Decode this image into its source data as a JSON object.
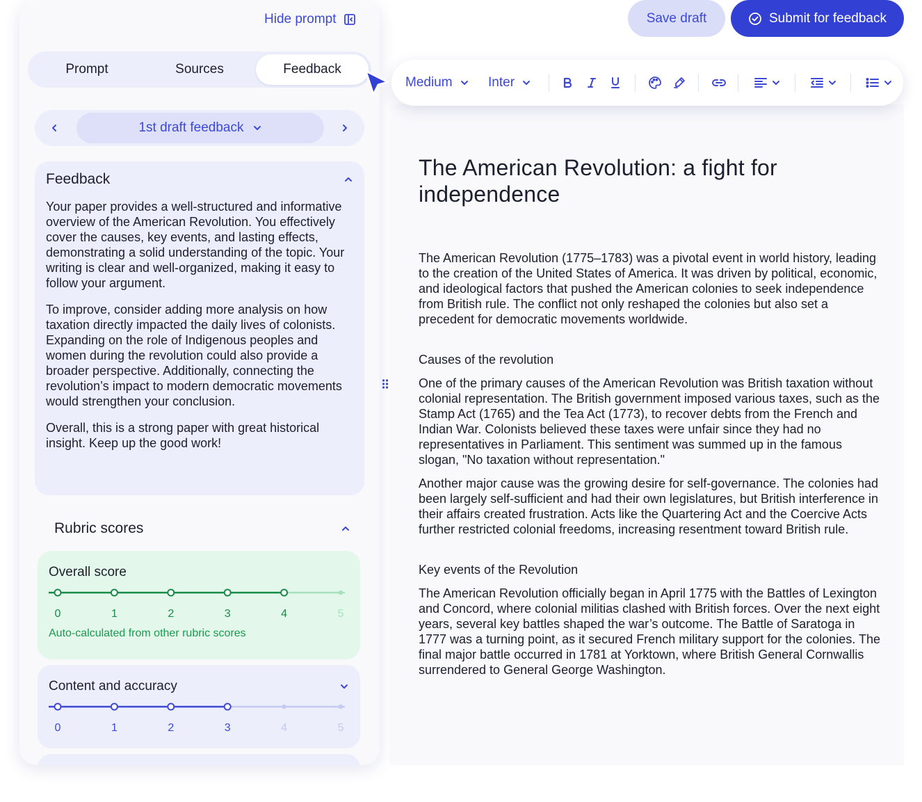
{
  "panel": {
    "hide_prompt_label": "Hide prompt",
    "tabs": [
      {
        "label": "Prompt",
        "active": false
      },
      {
        "label": "Sources",
        "active": false
      },
      {
        "label": "Feedback",
        "active": true
      }
    ],
    "draft_selector": "1st draft feedback",
    "feedback": {
      "title": "Feedback",
      "paragraphs": [
        "Your paper provides a well-structured and informative overview of the American Revolution. You effectively cover the causes, key events, and lasting effects, demonstrating a solid understanding of the topic. Your writing is clear and well-organized, making it easy to follow your argument.",
        "To improve, consider adding more analysis on how taxation directly impacted the daily lives of colonists. Expanding on the role of Indigenous peoples and women during the revolution could also provide a broader perspective. Additionally, connecting the revolution’s impact to modern democratic movements would strengthen your conclusion.",
        "Overall, this is a strong paper with great historical insight. Keep up the good work!"
      ]
    },
    "rubric": {
      "title": "Rubric scores",
      "overall": {
        "label": "Overall score",
        "score": 4,
        "scale": [
          "0",
          "1",
          "2",
          "3",
          "4",
          "5"
        ],
        "note": "Auto-calculated from other rubric scores",
        "color": "#1a8a48"
      },
      "content": {
        "label": "Content and accuracy",
        "score": 3,
        "scale": [
          "0",
          "1",
          "2",
          "3",
          "4",
          "5"
        ],
        "color": "#3d49d4"
      }
    }
  },
  "actions": {
    "save_label": "Save draft",
    "submit_label": "Submit for feedback"
  },
  "toolbar": {
    "text_style": "Medium",
    "font": "Inter",
    "icons": [
      "bold-icon",
      "italic-icon",
      "underline-icon",
      "palette-icon",
      "highlighter-icon",
      "link-icon",
      "align-left-icon",
      "indent-icon",
      "bullet-list-icon"
    ]
  },
  "document": {
    "title": "The American Revolution: a fight for independence",
    "intro": "The American Revolution (1775–1783) was a pivotal event in world history, leading to the creation of the United States of America. It was driven by political, economic, and ideological factors that pushed the American colonies to seek independence from British rule. The conflict not only reshaped the colonies but also set a precedent for democratic movements worldwide.",
    "section1": {
      "heading": "Causes of the revolution",
      "p1": "One of the primary causes of the American Revolution was British taxation without colonial representation. The British government imposed various taxes, such as the Stamp Act (1765) and the Tea Act (1773), to recover debts from the French and Indian War. Colonists believed these taxes were unfair since they had no representatives in Parliament. This sentiment was summed up in the famous slogan, \"No taxation without representation.\"",
      "p2": "Another major cause was the growing desire for self-governance. The colonies had been largely self-sufficient and had their own legislatures, but British interference in their affairs created frustration. Acts like the Quartering Act and the Coercive Acts further restricted colonial freedoms, increasing resentment toward British rule."
    },
    "section2": {
      "heading": "Key events of the Revolution",
      "p1": "The American Revolution officially began in April 1775 with the Battles of Lexington and Concord, where colonial militias clashed with British forces. Over the next eight years, several key battles shaped the war’s outcome. The Battle of Saratoga in 1777 was a turning point, as it secured French military support for the colonies. The final major battle occurred in 1781 at Yorktown, where British General Cornwallis surrendered to General George Washington."
    }
  }
}
